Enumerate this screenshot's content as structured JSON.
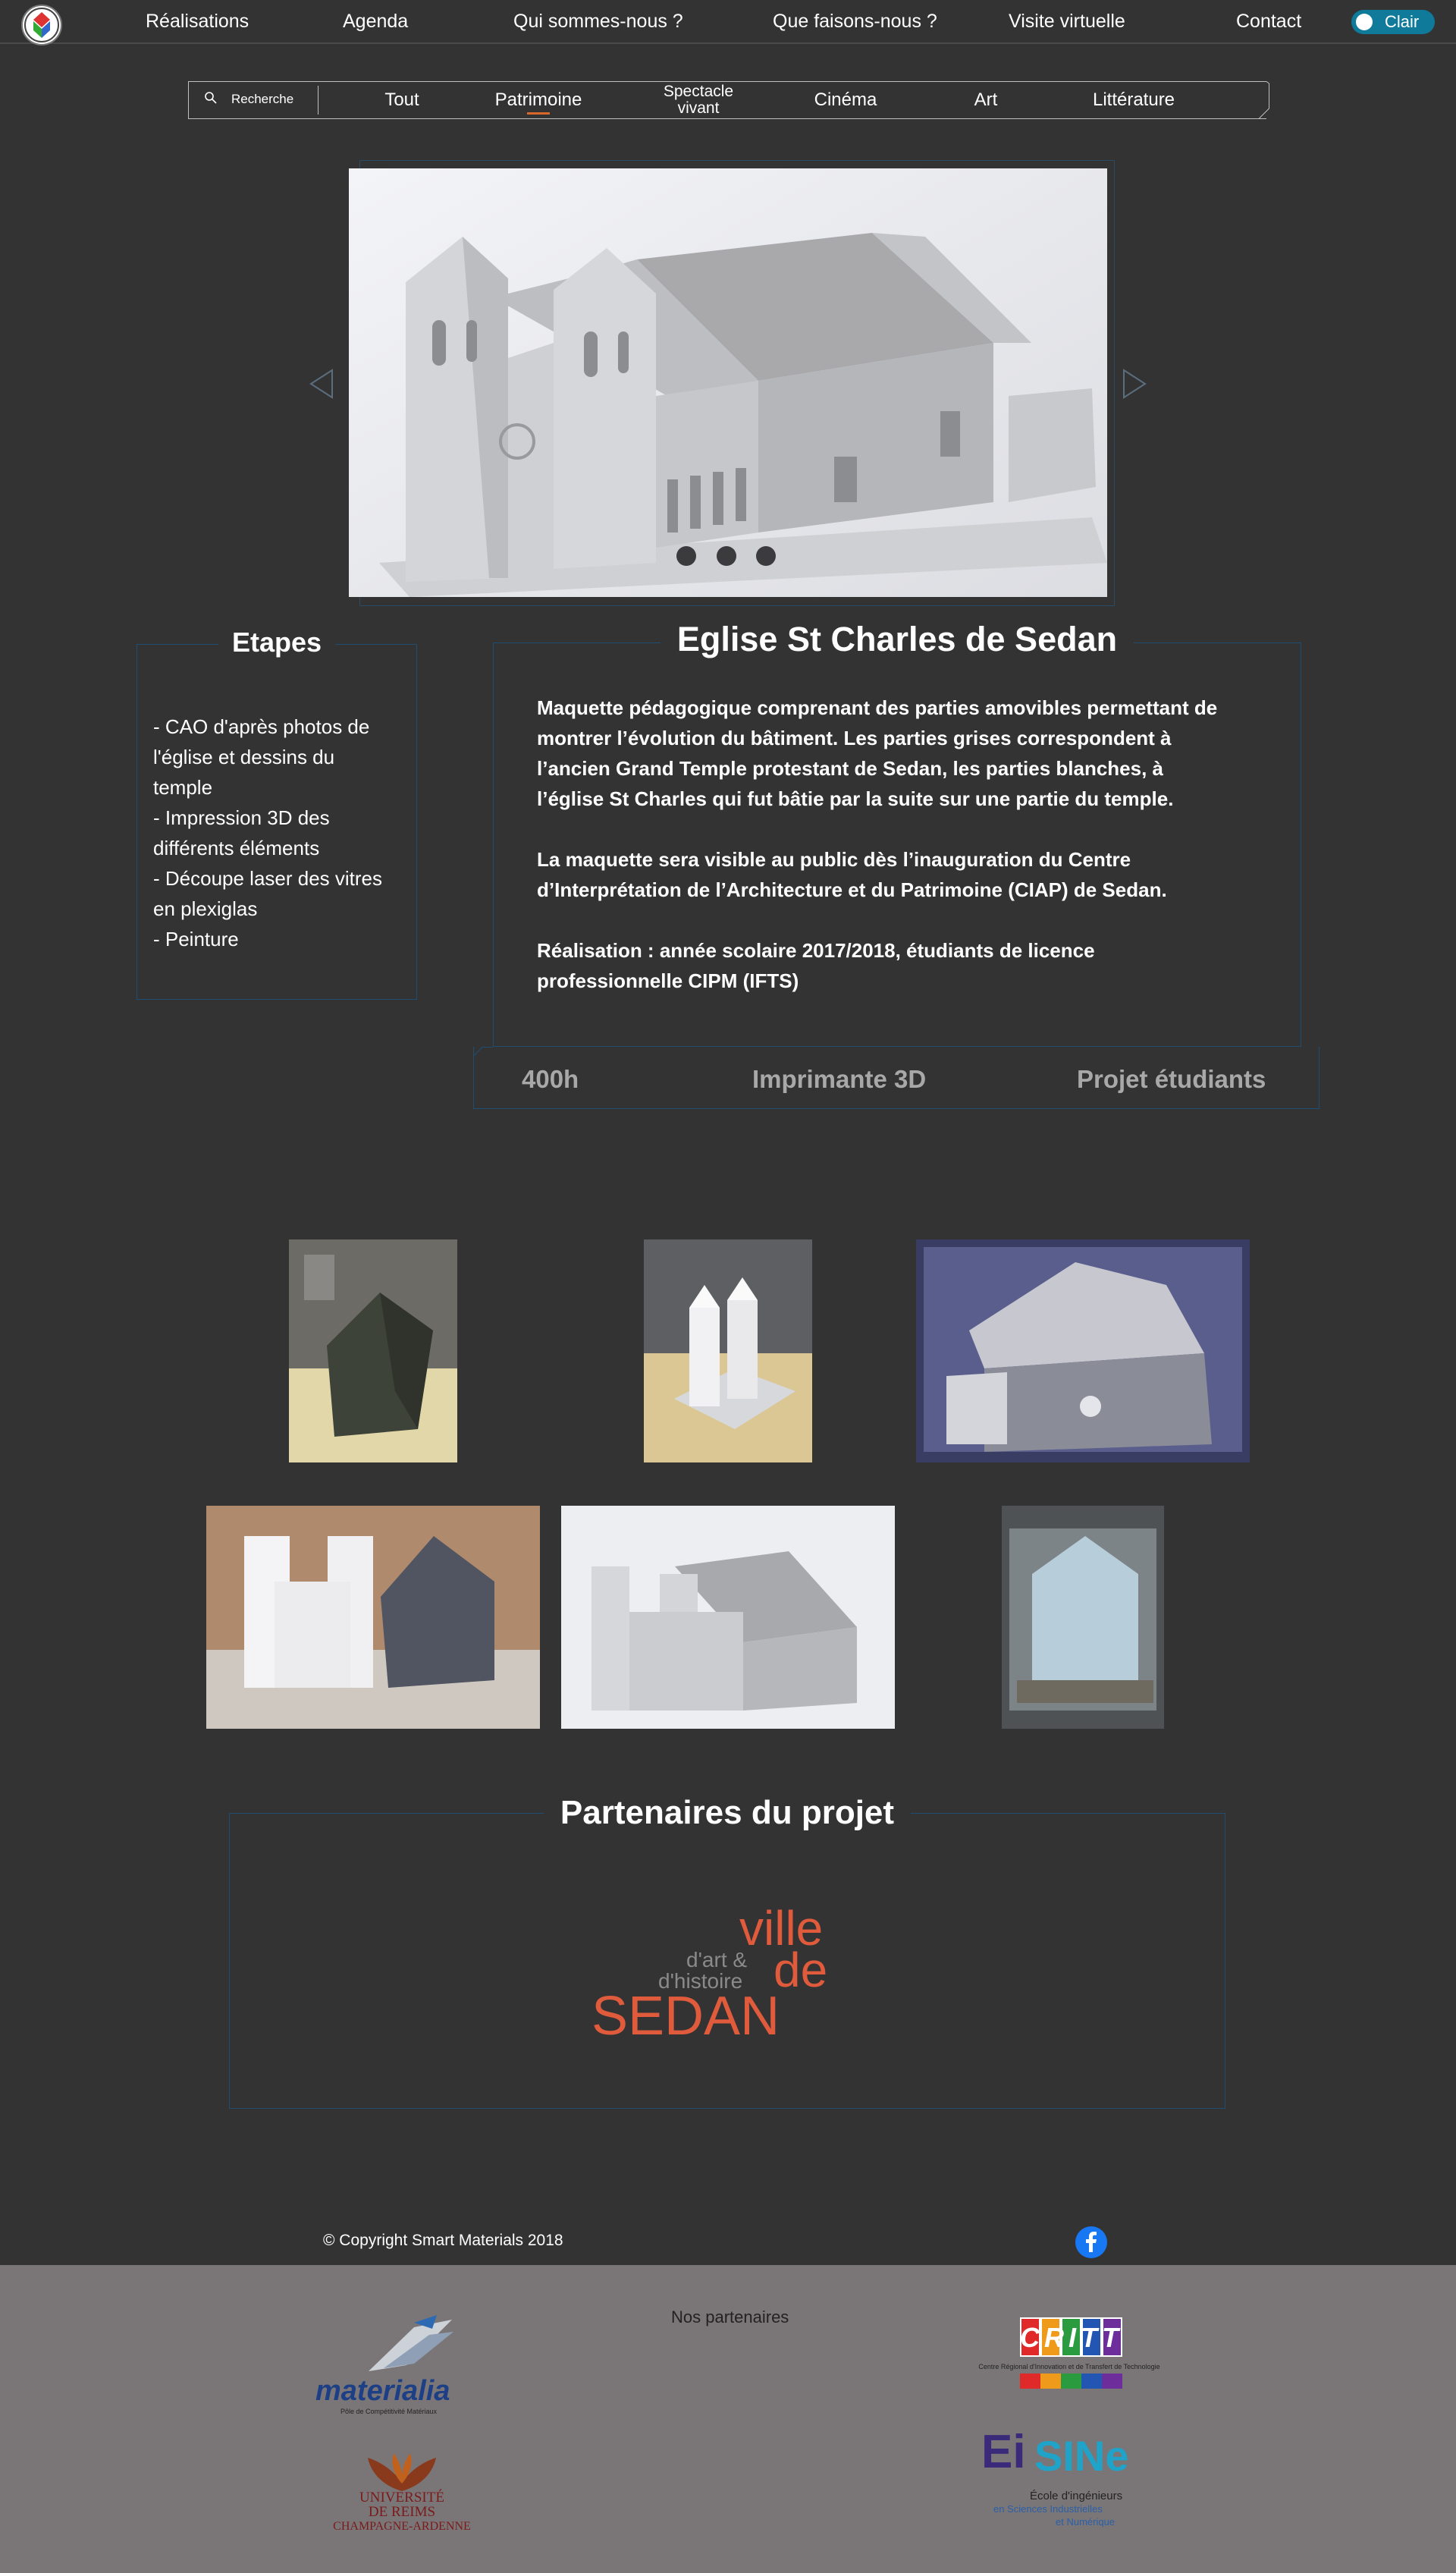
{
  "nav": {
    "items": [
      "Réalisations",
      "Agenda",
      "Qui sommes-nous ?",
      "Que faisons-nous ?",
      "Visite virtuelle",
      "Contact"
    ],
    "toggle_label": "Clair"
  },
  "filters": {
    "search_label": "Recherche",
    "items": [
      "Tout",
      "Patrimoine",
      "Spectacle vivant",
      "Cinéma",
      "Art",
      "Littérature"
    ],
    "active": "Patrimoine"
  },
  "steps": {
    "title": "Etapes",
    "text": "- CAO d'après photos de\nl'église et dessins du\ntemple\n- Impression 3D des\ndifférents éléments\n- Découpe laser des vitres\nen plexiglas\n- Peinture"
  },
  "project": {
    "title": "Eglise St Charles de Sedan",
    "paragraphs": [
      "Maquette pédagogique comprenant des parties amovibles permettant de montrer l’évolution du bâtiment. Les parties grises correspondent à l’ancien Grand Temple protestant de Sedan, les parties blanches, à l’église St Charles qui fut bâtie par la suite sur une partie du temple.",
      "La maquette sera visible au public dès l’inauguration du Centre d’Interprétation de l’Architecture et du Patrimoine (CIAP) de Sedan.",
      "Réalisation : année scolaire 2017/2018, étudiants de licence professionnelle CIPM (IFTS)"
    ],
    "stats": [
      "400h",
      "Imprimante 3D",
      "Projet étudiants"
    ]
  },
  "partners": {
    "title": "Partenaires du projet",
    "logo_lines": [
      "ville",
      "de",
      "d'art &",
      "d'histoire",
      "SEDAN"
    ]
  },
  "copyright": "© Copyright Smart Materials 2018",
  "footer": {
    "title": "Nos partenaires",
    "materialia": [
      "materialia",
      "Pôle de Compétitivité Matériaux"
    ],
    "critt": [
      "CRITT",
      "Centre Régional d'Innovation et de Transfert de Technologie"
    ],
    "reims": [
      "UNIVERSITÉ",
      "DE REIMS",
      "CHAMPAGNE-ARDENNE"
    ],
    "eisine": [
      "Ei",
      "SINe",
      "École d'ingénieurs",
      "en Sciences Industrielles",
      "et Numérique"
    ]
  },
  "colors": {
    "background": "#333334",
    "border_blue": "#1f4e72",
    "accent_orange": "#d9662a",
    "toggle": "#0f7a99",
    "footer": "#7a7677"
  }
}
